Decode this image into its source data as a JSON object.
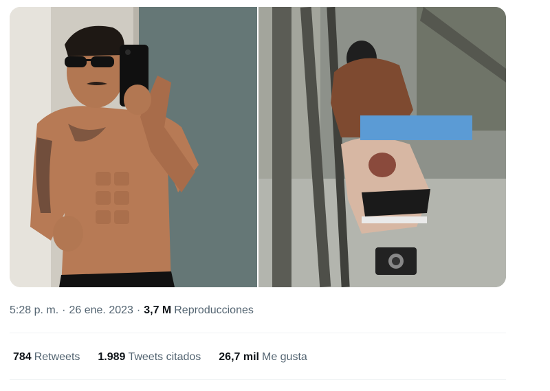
{
  "tweet": {
    "media": [
      {
        "kind": "photo",
        "subject": "mirror-selfie"
      },
      {
        "kind": "photo",
        "subject": "alley-scene",
        "censor_color": "#5b9bd5"
      }
    ],
    "meta": {
      "time": "5:28 p. m.",
      "separator": "·",
      "date": "26 ene. 2023",
      "views_count": "3,7 M",
      "views_label": "Reproducciones"
    },
    "stats": [
      {
        "value": "784",
        "label": "Retweets"
      },
      {
        "value": "1.989",
        "label": "Tweets citados"
      },
      {
        "value": "26,7 mil",
        "label": "Me gusta"
      }
    ]
  },
  "colors": {
    "text_primary": "#0f1419",
    "text_secondary": "#536471",
    "divider": "#eff3f4",
    "censor_bar": "#5b9bd5"
  }
}
